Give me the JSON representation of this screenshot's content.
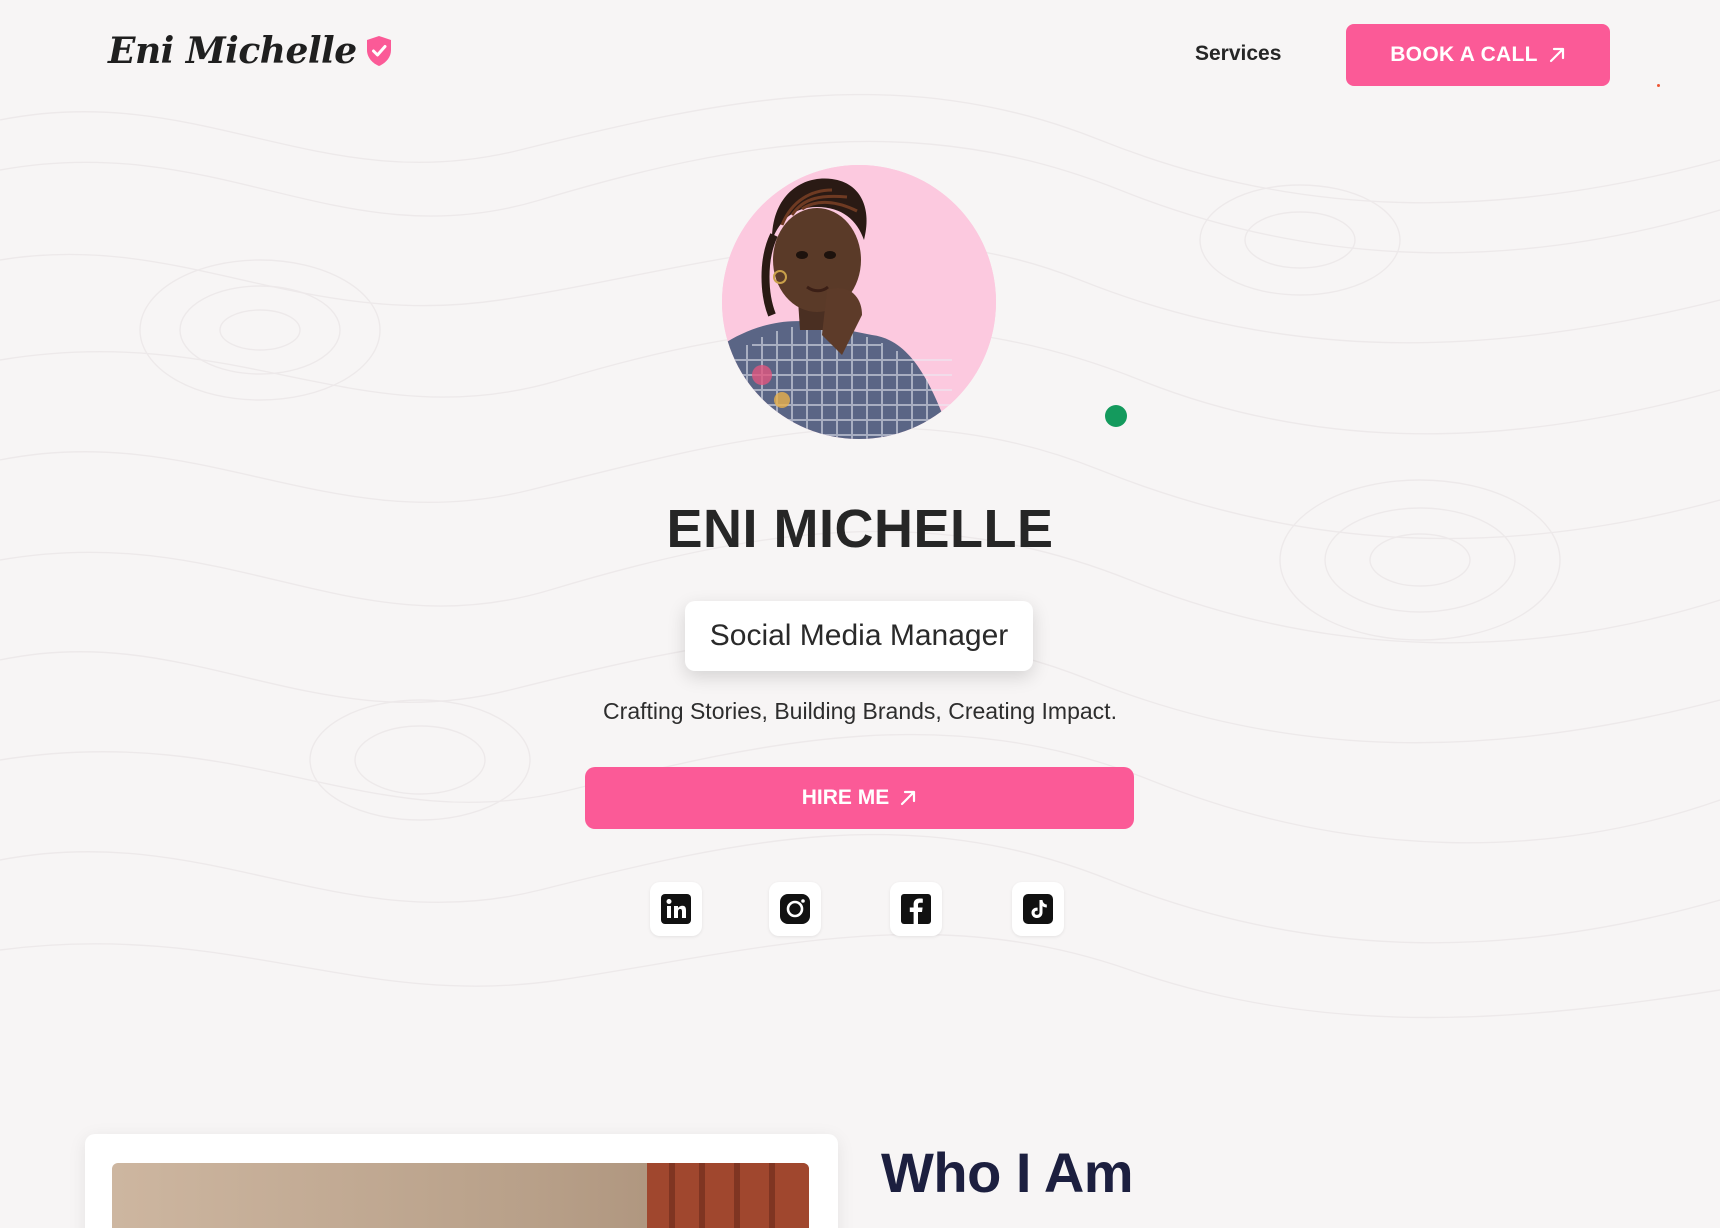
{
  "header": {
    "logo_text": "Eni Michelle",
    "nav_services": "Services",
    "book_call_label": "BOOK A CALL"
  },
  "hero": {
    "name": "ENI MICHELLE",
    "role": "Social Media Manager",
    "tagline": "Crafting Stories, Building Brands, Creating Impact.",
    "hire_label": "HIRE ME"
  },
  "socials": [
    "linkedin-icon",
    "instagram-icon",
    "facebook-icon",
    "tiktok-icon"
  ],
  "about": {
    "heading": "Who I Am"
  },
  "colors": {
    "accent": "#fb5a97",
    "avatar_bg": "#fcc9df",
    "online": "#149a5d",
    "heading_dark": "#1c1f3f"
  }
}
